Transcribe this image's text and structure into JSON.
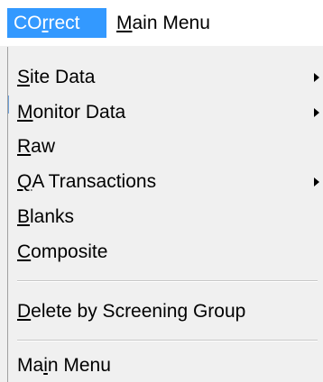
{
  "menubar": {
    "active_menu": {
      "prefix": "CO",
      "accel": "r",
      "suffix": "rect"
    },
    "main_menu": {
      "accel": "M",
      "suffix": "ain Menu"
    }
  },
  "dropdown": {
    "items": [
      {
        "accel": "S",
        "rest": "ite Data",
        "submenu": true
      },
      {
        "accel": "M",
        "rest": "onitor Data",
        "submenu": true
      },
      {
        "accel": "R",
        "rest": "aw",
        "submenu": false
      },
      {
        "accel": "Q",
        "rest": "A Transactions",
        "submenu": true
      },
      {
        "accel": "B",
        "rest": "lanks",
        "submenu": false
      },
      {
        "accel": "C",
        "rest": "omposite",
        "submenu": false
      },
      {
        "accel": "D",
        "rest": "elete by Screening Group",
        "submenu": false
      },
      {
        "pre": "Ma",
        "accel": "i",
        "rest": "n Menu",
        "submenu": false
      }
    ]
  },
  "colors": {
    "highlight": "#3399ff",
    "menu_bg": "#f0f0f0",
    "menubar_bg": "#ffffff"
  }
}
